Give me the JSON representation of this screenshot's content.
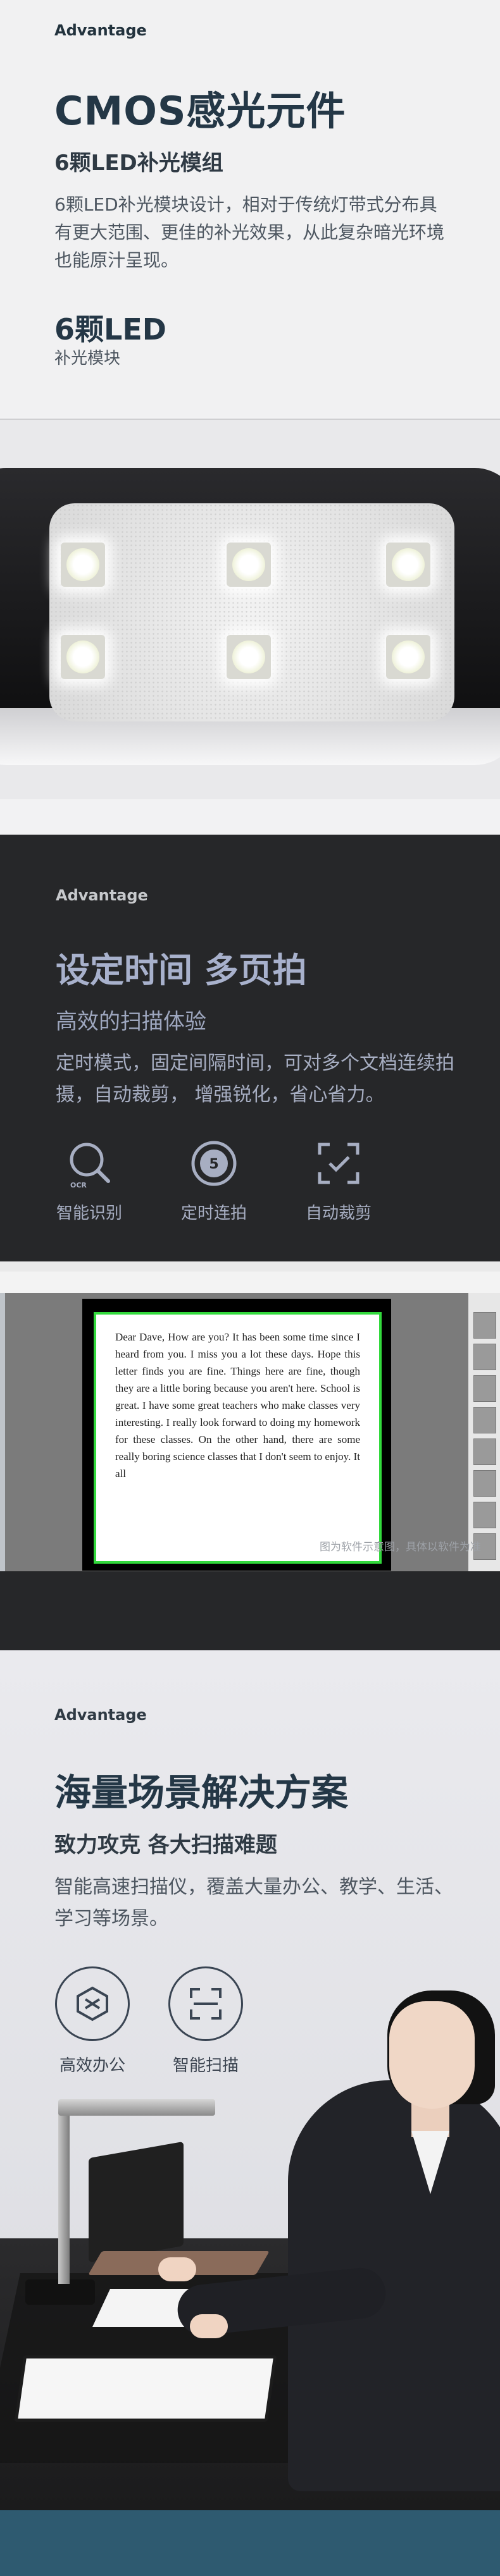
{
  "section1": {
    "tag": "Advantage",
    "title": "CMOS感光元件",
    "subtitle": "6颗LED补光模组",
    "desc": "6颗LED补光模块设计，相对于传统灯带式分布具有更大范围、更佳的补光效果，从此复杂暗光环境也能原汁呈现。",
    "spec_value": "6颗LED",
    "spec_label": "补光模块"
  },
  "section2": {
    "tag": "Advantage",
    "title": "设定时间 多页拍",
    "subtitle": "高效的扫描体验",
    "desc": "定时模式，固定间隔时间，可对多个文档连续拍摄，自动裁剪， 增强锐化，省心省力。",
    "features": [
      {
        "icon": "ocr-search-icon",
        "label": "智能识别"
      },
      {
        "icon": "timer-icon",
        "label": "定时连拍"
      },
      {
        "icon": "auto-crop-icon",
        "label": "自动裁剪"
      }
    ],
    "document_text": "Dear Dave, How are you? It has been some time since I heard from you. I miss you a lot these days. Hope this letter finds you are fine. Things here are fine, though they are a little boring because you aren't here. School is great. I have some great teachers who make classes very interesting. I really look forward to doing my homework for these classes. On the other hand, there are some really boring science classes that I don't seem to enjoy. It all",
    "caption": "图为软件示意图，具体以软件为准"
  },
  "section3": {
    "tag": "Advantage",
    "title": "海量场景解决方案",
    "subtitle": "致力攻克 各大扫描难题",
    "desc": "智能高速扫描仪，覆盖大量办公、教学、生活、学习等场景。",
    "features": [
      {
        "icon": "efficient-office-icon",
        "label": "高效办公"
      },
      {
        "icon": "smart-scan-icon",
        "label": "智能扫描"
      }
    ]
  }
}
